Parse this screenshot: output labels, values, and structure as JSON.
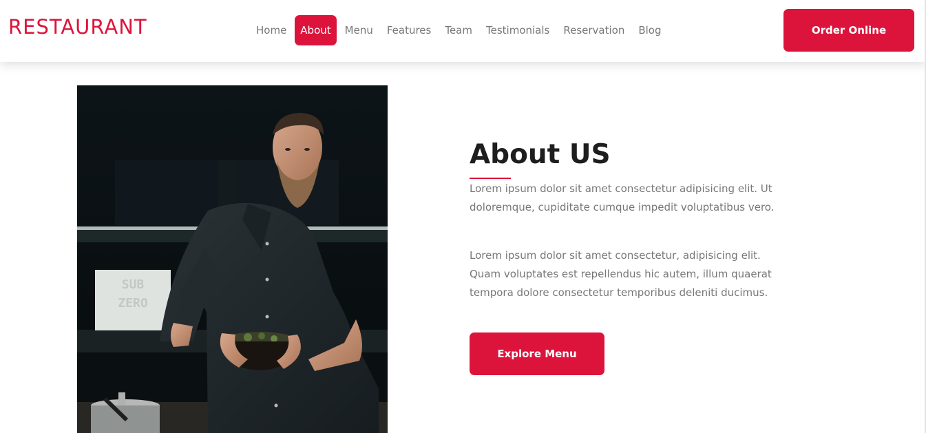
{
  "brand": {
    "logo": "RESTAURANT",
    "accent_color": "#dc143c"
  },
  "nav": {
    "items": [
      {
        "label": "Home",
        "active": false
      },
      {
        "label": "About",
        "active": true
      },
      {
        "label": "Menu",
        "active": false
      },
      {
        "label": "Features",
        "active": false
      },
      {
        "label": "Team",
        "active": false
      },
      {
        "label": "Testimonials",
        "active": false
      },
      {
        "label": "Reservation",
        "active": false
      },
      {
        "label": "Blog",
        "active": false
      }
    ],
    "cta_label": "Order Online"
  },
  "about": {
    "title": "About US",
    "paragraph1": "Lorem ipsum dolor sit amet consectetur adipisicing elit. Ut doloremque, cupiditate cumque impedit voluptatibus vero.",
    "paragraph2": "Lorem ipsum dolor sit amet consectetur, adipisicing elit. Quam voluptates est repellendus hic autem, illum quaerat tempora dolore consectetur temporibus deleniti ducimus.",
    "button_label": "Explore Menu",
    "image_sign_text": [
      "SUB",
      "ZERO"
    ]
  }
}
